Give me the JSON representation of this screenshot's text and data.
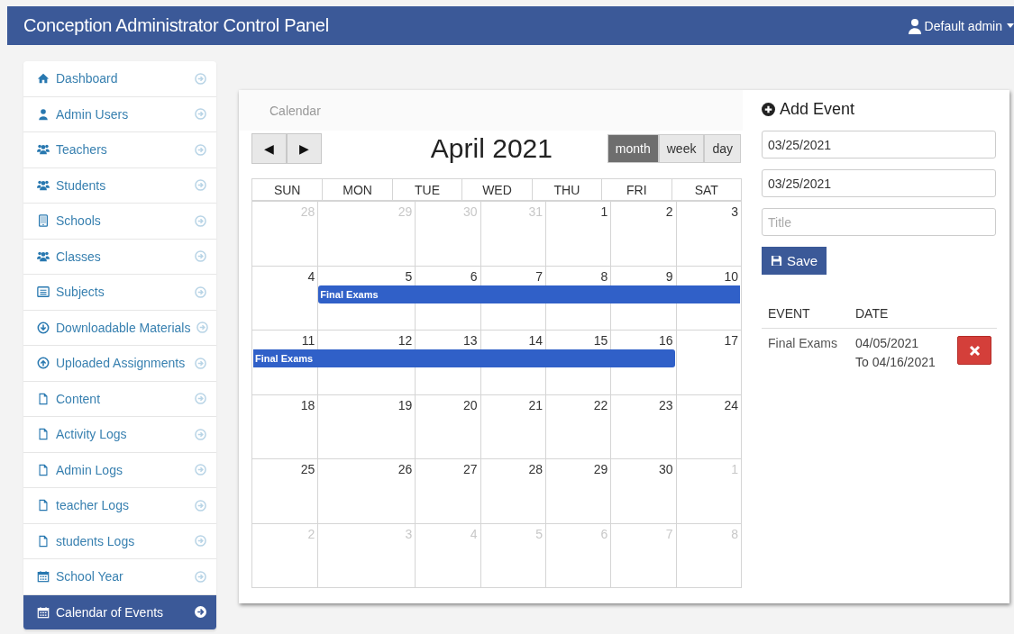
{
  "header": {
    "title": "Conception Administrator Control Panel",
    "user": "Default admin"
  },
  "sidebar": {
    "items": [
      {
        "label": "Dashboard",
        "kind": "home",
        "selected": false
      },
      {
        "label": "Admin Users",
        "kind": "user",
        "selected": false
      },
      {
        "label": "Teachers",
        "kind": "group",
        "selected": false
      },
      {
        "label": "Students",
        "kind": "group",
        "selected": false
      },
      {
        "label": "Schools",
        "kind": "building",
        "selected": false
      },
      {
        "label": "Classes",
        "kind": "group",
        "selected": false
      },
      {
        "label": "Subjects",
        "kind": "list",
        "selected": false
      },
      {
        "label": "Downloadable Materials",
        "kind": "download",
        "selected": false
      },
      {
        "label": "Uploaded Assignments",
        "kind": "upload",
        "selected": false
      },
      {
        "label": "Content",
        "kind": "file",
        "selected": false
      },
      {
        "label": "Activity Logs",
        "kind": "file",
        "selected": false
      },
      {
        "label": "Admin Logs",
        "kind": "file",
        "selected": false
      },
      {
        "label": "teacher Logs",
        "kind": "file",
        "selected": false
      },
      {
        "label": "students Logs",
        "kind": "file",
        "selected": false
      },
      {
        "label": "School Year",
        "kind": "calendar",
        "selected": false
      },
      {
        "label": "Calendar of Events",
        "kind": "calendar",
        "selected": true
      }
    ]
  },
  "calendar": {
    "heading": "Calendar",
    "prev": "◀",
    "next": "▶",
    "title": "April 2021",
    "views": [
      {
        "label": "month",
        "selected": true
      },
      {
        "label": "week",
        "selected": false
      },
      {
        "label": "day",
        "selected": false
      }
    ],
    "weekdays": [
      "SUN",
      "MON",
      "TUE",
      "WED",
      "THU",
      "FRI",
      "SAT"
    ],
    "weeks": [
      {
        "days": [
          {
            "num": "28",
            "other_month": true
          },
          {
            "num": "29",
            "other_month": true
          },
          {
            "num": "30",
            "other_month": true
          },
          {
            "num": "31",
            "other_month": true
          },
          {
            "num": "1",
            "other_month": false
          },
          {
            "num": "2",
            "other_month": false
          },
          {
            "num": "3",
            "other_month": false
          }
        ]
      },
      {
        "days": [
          {
            "num": "4",
            "other_month": false,
            "event": false
          },
          {
            "num": "5",
            "other_month": false,
            "event": true
          },
          {
            "num": "6",
            "other_month": false,
            "event": true
          },
          {
            "num": "7",
            "other_month": false,
            "event": true
          },
          {
            "num": "8",
            "other_month": false,
            "event": true
          },
          {
            "num": "9",
            "other_month": false,
            "event": true
          },
          {
            "num": "10",
            "other_month": false,
            "event": true
          }
        ],
        "event_title": "Final Exams"
      },
      {
        "days": [
          {
            "num": "11",
            "other_month": false,
            "event": true
          },
          {
            "num": "12",
            "other_month": false,
            "event": true
          },
          {
            "num": "13",
            "other_month": false,
            "event": true
          },
          {
            "num": "14",
            "other_month": false,
            "event": true
          },
          {
            "num": "15",
            "other_month": false,
            "event": true
          },
          {
            "num": "16",
            "other_month": false,
            "event": true
          },
          {
            "num": "17",
            "other_month": false,
            "event": false
          }
        ],
        "event_title": "Final Exams"
      },
      {
        "days": [
          {
            "num": "18",
            "other_month": false
          },
          {
            "num": "19",
            "other_month": false
          },
          {
            "num": "20",
            "other_month": false
          },
          {
            "num": "21",
            "other_month": false
          },
          {
            "num": "22",
            "other_month": false
          },
          {
            "num": "23",
            "other_month": false
          },
          {
            "num": "24",
            "other_month": false
          }
        ]
      },
      {
        "days": [
          {
            "num": "25",
            "other_month": false
          },
          {
            "num": "26",
            "other_month": false
          },
          {
            "num": "27",
            "other_month": false
          },
          {
            "num": "28",
            "other_month": false
          },
          {
            "num": "29",
            "other_month": false
          },
          {
            "num": "30",
            "other_month": false
          },
          {
            "num": "1",
            "other_month": true
          }
        ]
      },
      {
        "days": [
          {
            "num": "2",
            "other_month": true
          },
          {
            "num": "3",
            "other_month": true
          },
          {
            "num": "4",
            "other_month": true
          },
          {
            "num": "5",
            "other_month": true
          },
          {
            "num": "6",
            "other_month": true
          },
          {
            "num": "7",
            "other_month": true
          },
          {
            "num": "8",
            "other_month": true
          }
        ]
      }
    ]
  },
  "add_event": {
    "heading": "Add Event",
    "start_date": "03/25/2021",
    "end_date": "03/25/2021",
    "title_placeholder": "Title",
    "save": "Save"
  },
  "events_table": {
    "columns": [
      "EVENT",
      "DATE"
    ],
    "rows": [
      {
        "event": "Final Exams",
        "date_from": "04/05/2021",
        "date_to": "To 04/16/2021"
      }
    ]
  }
}
